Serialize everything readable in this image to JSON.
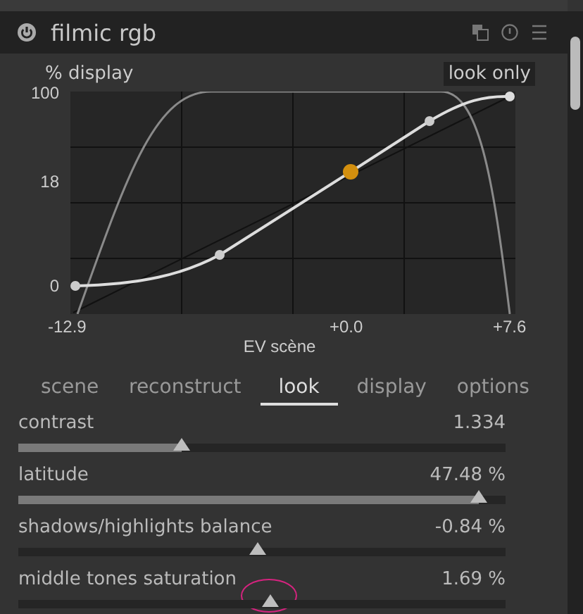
{
  "module": {
    "title": "filmic rgb",
    "enabled": true
  },
  "graph": {
    "y_title": "% display",
    "mode_label": "look only",
    "y_ticks": [
      "100",
      "18",
      "0"
    ],
    "x_ticks": [
      "-12.9",
      "+0.0",
      "+7.6"
    ],
    "x_title": "EV scène"
  },
  "tabs": [
    {
      "label": "scene",
      "selected": false
    },
    {
      "label": "reconstruct",
      "selected": false
    },
    {
      "label": "look",
      "selected": true
    },
    {
      "label": "display",
      "selected": false
    },
    {
      "label": "options",
      "selected": false
    }
  ],
  "sliders": [
    {
      "label": "contrast",
      "value": "1.334",
      "kind": "fill",
      "level": 0.334,
      "highlighted": false
    },
    {
      "label": "latitude",
      "value": "47.48 %",
      "kind": "fill",
      "level": 0.944,
      "highlighted": false
    },
    {
      "label": "shadows/highlights balance",
      "value": "-0.84 %",
      "kind": "centered",
      "level": 0.492,
      "highlighted": false
    },
    {
      "label": "middle tones saturation",
      "value": "1.69 %",
      "kind": "centered",
      "level": 0.517,
      "highlighted": true
    }
  ]
}
